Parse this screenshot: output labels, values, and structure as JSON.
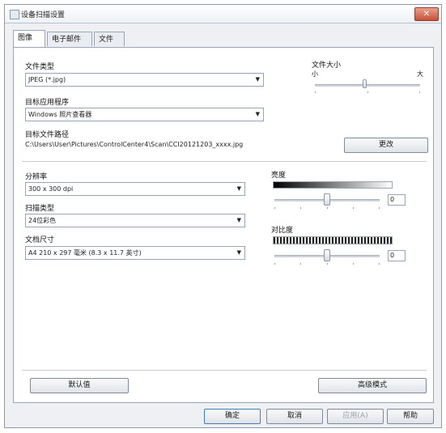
{
  "window": {
    "title": "设备扫描设置",
    "close_label": "✕"
  },
  "tabs": [
    {
      "label": "图像"
    },
    {
      "label": "电子邮件"
    },
    {
      "label": "文件"
    }
  ],
  "file_type": {
    "label": "文件类型",
    "value": "JPEG (*.jpg)"
  },
  "file_size": {
    "label": "文件大小",
    "min_label": "小",
    "max_label": "大"
  },
  "target_app": {
    "label": "目标应用程序",
    "value": "Windows 照片查看器"
  },
  "target_path": {
    "label": "目标文件路径",
    "value": "C:\\Users\\User\\Pictures\\ControlCenter4\\Scan\\CCI20121203_xxxx.jpg",
    "change_button": "更改"
  },
  "resolution": {
    "label": "分辨率",
    "value": "300 x 300 dpi"
  },
  "scan_type": {
    "label": "扫描类型",
    "value": "24位彩色"
  },
  "doc_size": {
    "label": "文档尺寸",
    "value": "A4 210 x 297 毫米 (8.3 x 11.7 英寸)"
  },
  "brightness": {
    "label": "亮度",
    "value": "0"
  },
  "contrast": {
    "label": "对比度",
    "value": "0"
  },
  "buttons": {
    "default": "默认值",
    "advanced": "高级模式",
    "ok": "确定",
    "cancel": "取消",
    "apply": "应用(A)",
    "help": "帮助"
  },
  "colors": {
    "accent": "#3c7fb1",
    "close": "#c7513a"
  }
}
